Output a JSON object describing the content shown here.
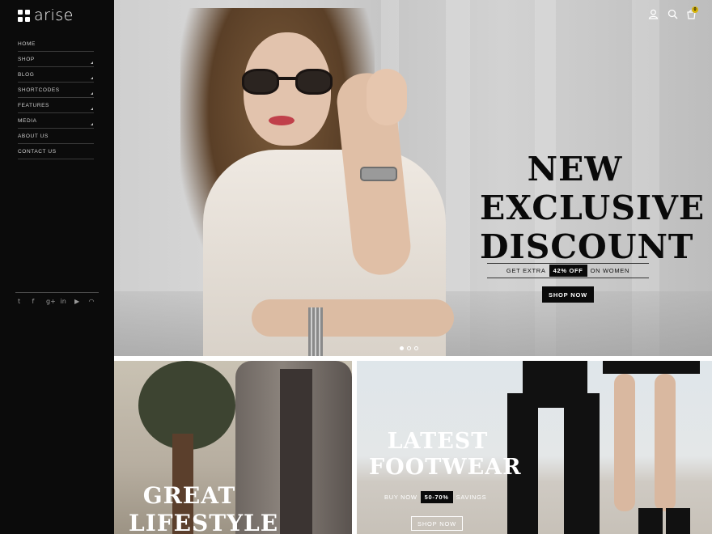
{
  "brand": {
    "name": "arise"
  },
  "sidebar": {
    "menu": [
      {
        "label": "HOME",
        "has_submenu": false
      },
      {
        "label": "SHOP",
        "has_submenu": true
      },
      {
        "label": "BLOG",
        "has_submenu": true
      },
      {
        "label": "SHORTCODES",
        "has_submenu": true
      },
      {
        "label": "FEATURES",
        "has_submenu": true
      },
      {
        "label": "MEDIA",
        "has_submenu": true
      },
      {
        "label": "ABOUT US",
        "has_submenu": false
      },
      {
        "label": "CONTACT US",
        "has_submenu": false
      }
    ],
    "social": [
      {
        "icon": "twitter-icon",
        "glyph": "t"
      },
      {
        "icon": "facebook-icon",
        "glyph": "f"
      },
      {
        "icon": "google-plus-icon",
        "glyph": "g+"
      },
      {
        "icon": "linkedin-icon",
        "glyph": "in"
      },
      {
        "icon": "youtube-icon",
        "glyph": "▶"
      },
      {
        "icon": "rss-icon",
        "glyph": "◠"
      }
    ]
  },
  "header": {
    "icons": [
      "user-icon",
      "search-icon",
      "cart-icon"
    ],
    "cart_count": "0"
  },
  "hero": {
    "title_lines": [
      "NEW",
      "EXCLUSIVE",
      "DISCOUNT"
    ],
    "offer_prefix": "GET EXTRA",
    "offer_badge": "42% OFF",
    "offer_suffix": "ON WOMEN",
    "button": "SHOP NOW",
    "slides": 3,
    "active_slide": 1
  },
  "tiles": {
    "left": {
      "title_lines": [
        "GREAT",
        "LIFESTYLE"
      ]
    },
    "right": {
      "title_lines": [
        "LATEST",
        "FOOTWEAR"
      ],
      "offer_prefix": "BUY NOW",
      "offer_badge": "50-70%",
      "offer_suffix": "SAVINGS",
      "button": "SHOP NOW"
    }
  },
  "colors": {
    "sidebar_bg": "#0b0b0b",
    "accent": "#d7b40c",
    "text_dark": "#0a0a0a"
  }
}
